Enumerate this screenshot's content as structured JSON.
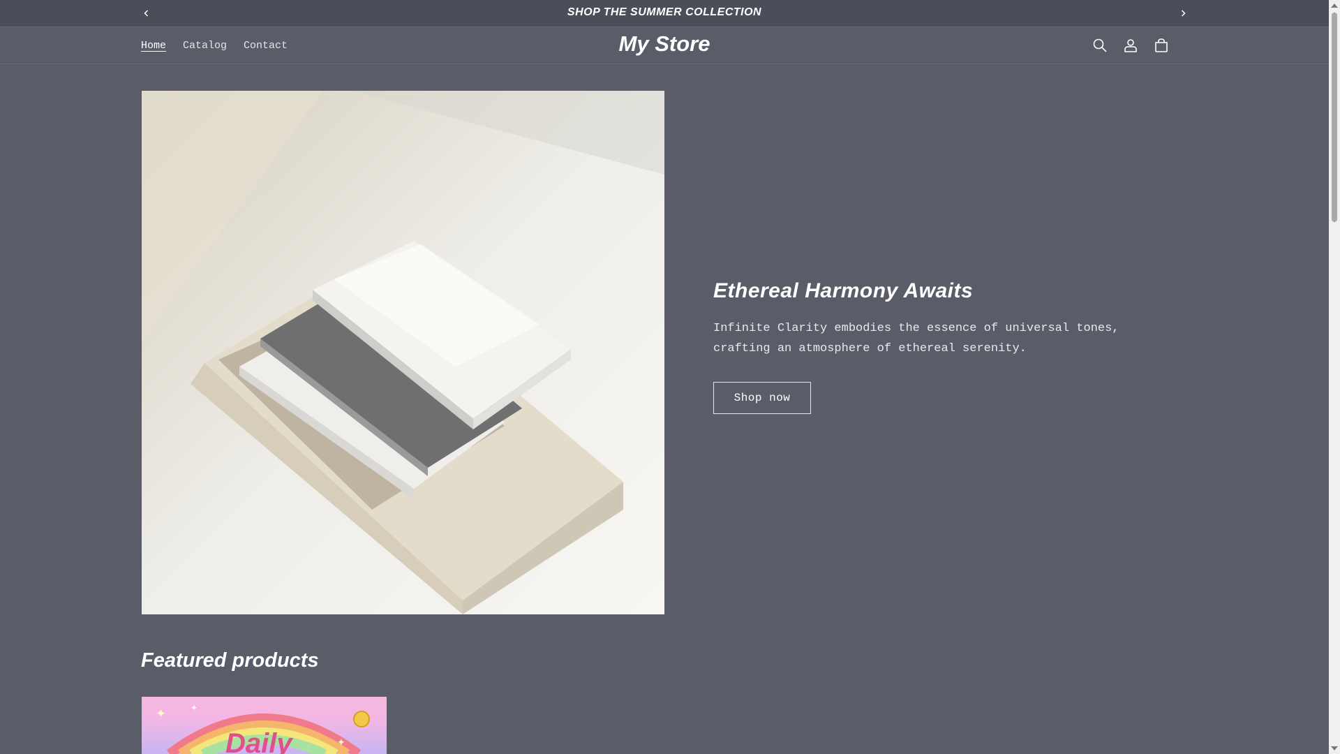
{
  "announcement": {
    "text": "SHOP THE SUMMER COLLECTION",
    "prev_icon": "chevron-left-icon",
    "next_icon": "chevron-right-icon"
  },
  "header": {
    "logo": "My Store",
    "nav": [
      {
        "label": "Home",
        "active": true
      },
      {
        "label": "Catalog",
        "active": false
      },
      {
        "label": "Contact",
        "active": false
      }
    ],
    "icons": [
      "search-icon",
      "account-icon",
      "cart-icon"
    ]
  },
  "hero": {
    "title": "Ethereal Harmony Awaits",
    "description": "Infinite Clarity embodies the essence of universal tones, crafting an atmosphere of ethereal serenity.",
    "button_label": "Shop now"
  },
  "featured": {
    "title": "Featured products",
    "product_image_text": "Daily"
  },
  "colors": {
    "background": "#5a5c68",
    "announcement_bg": "#4b4d58",
    "text": "#ffffff"
  }
}
